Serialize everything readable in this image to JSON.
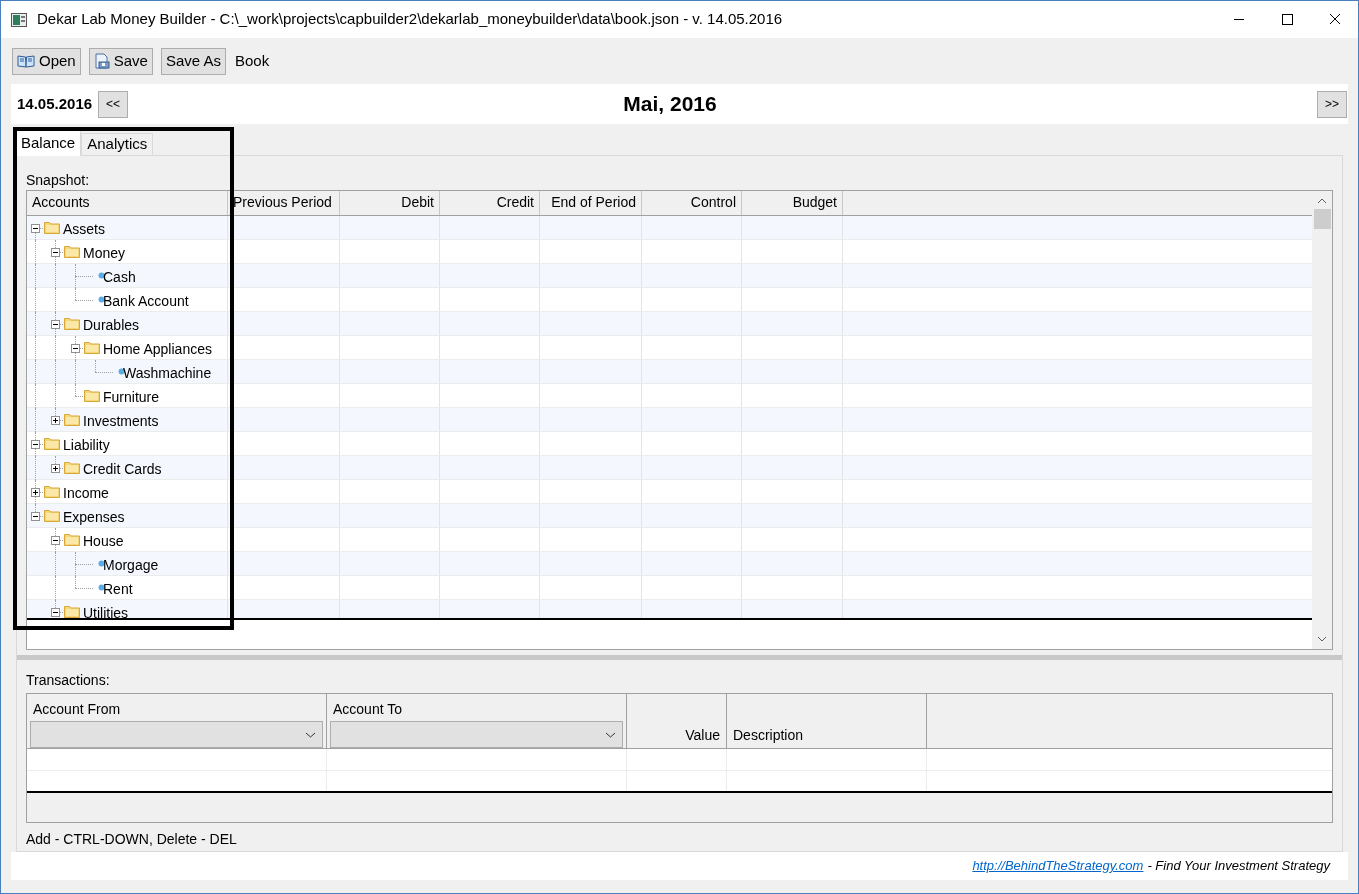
{
  "window": {
    "title": "Dekar Lab Money Builder - C:\\_work\\projects\\capbuilder2\\dekarlab_moneybuilder\\data\\book.json - v. 14.05.2016"
  },
  "toolbar": {
    "buttons": [
      {
        "label": "Open",
        "kind": "open"
      },
      {
        "label": "Save",
        "kind": "save"
      },
      {
        "label": "Save As",
        "kind": "plain"
      }
    ],
    "label": "Book"
  },
  "date_bar": {
    "date": "14.05.2016",
    "prev": "<<",
    "month": "Mai, 2016",
    "next": ">>"
  },
  "tabs": [
    {
      "label": "Balance",
      "selected": true
    },
    {
      "label": "Analytics",
      "selected": false
    }
  ],
  "snapshot": {
    "label": "Snapshot:",
    "columns": [
      "Accounts",
      "Previous Period",
      "Debit",
      "Credit",
      "End of Period",
      "Control",
      "Budget"
    ],
    "tree": [
      {
        "label": "Assets",
        "kind": "folder",
        "expanded": true,
        "children": [
          {
            "label": "Money",
            "kind": "folder",
            "expanded": true,
            "children": [
              {
                "label": "Cash",
                "kind": "account"
              },
              {
                "label": "Bank Account",
                "kind": "account"
              }
            ]
          },
          {
            "label": "Durables",
            "kind": "folder",
            "expanded": true,
            "children": [
              {
                "label": "Home Appliances",
                "kind": "folder",
                "expanded": true,
                "children": [
                  {
                    "label": "Washmachine",
                    "kind": "account"
                  }
                ]
              },
              {
                "label": "Furniture",
                "kind": "folder"
              }
            ]
          },
          {
            "label": "Investments",
            "kind": "folder",
            "expanded": false
          }
        ]
      },
      {
        "label": "Liability",
        "kind": "folder",
        "expanded": true,
        "children": [
          {
            "label": "Credit Cards",
            "kind": "folder",
            "expanded": false
          }
        ]
      },
      {
        "label": "Income",
        "kind": "folder",
        "expanded": false
      },
      {
        "label": "Expenses",
        "kind": "folder",
        "expanded": true,
        "children": [
          {
            "label": "House",
            "kind": "folder",
            "expanded": true,
            "children": [
              {
                "label": "Morgage",
                "kind": "account"
              },
              {
                "label": "Rent",
                "kind": "account"
              }
            ]
          },
          {
            "label": "Utilities",
            "kind": "folder",
            "expanded": true
          }
        ]
      }
    ]
  },
  "transactions": {
    "label": "Transactions:",
    "columns": [
      {
        "label": "Account From",
        "kind": "combo"
      },
      {
        "label": "Account To",
        "kind": "combo"
      },
      {
        "label": "Value",
        "kind": "number"
      },
      {
        "label": "Description",
        "kind": "text"
      }
    ]
  },
  "hint": "Add - CTRL-DOWN, Delete - DEL",
  "footer": {
    "link": "http://BehindTheStrategy.com",
    "text": "- Find Your Investment Strategy"
  }
}
